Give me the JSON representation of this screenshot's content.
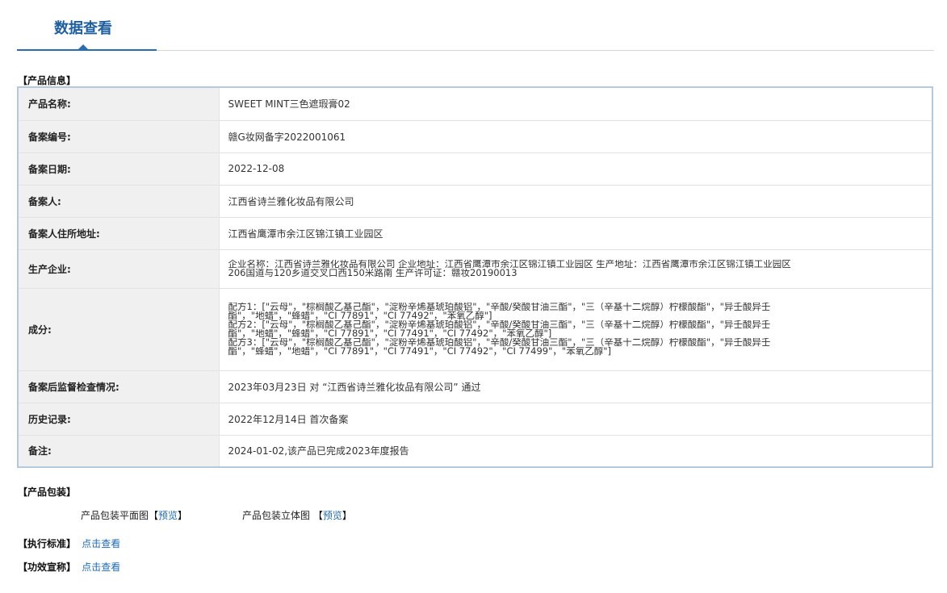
{
  "tab": {
    "title": "数据查看"
  },
  "product_info": {
    "heading": "【产品信息】",
    "rows": [
      {
        "label": "产品名称:",
        "value": "SWEET MINT三色遮瑕膏02"
      },
      {
        "label": "备案编号:",
        "value": "赣G妆网备字2022001061"
      },
      {
        "label": "备案日期:",
        "value": "2022-12-08"
      },
      {
        "label": "备案人:",
        "value": "江西省诗兰雅化妆品有限公司"
      },
      {
        "label": "备案人住所地址:",
        "value": "江西省鹰潭市余江区锦江镇工业园区"
      },
      {
        "label": "生产企业:",
        "lines": [
          "企业名称：江西省诗兰雅化妆品有限公司 企业地址：江西省鹰潭市余江区锦江镇工业园区 生产地址：江西省鹰潭市余江区锦江镇工业园区",
          "206国道与120乡道交叉口西150米路南 生产许可证：赣妆20190013"
        ]
      },
      {
        "label": "成分:",
        "lines": [
          "配方1：[\"云母\"，\"棕榈酸乙基己酯\"，\"淀粉辛烯基琥珀酸铝\"，\"辛酸/癸酸甘油三酯\"，\"三（辛基十二烷醇）柠檬酸酯\"，\"异壬酸异壬",
          "酯\"，\"地蜡\"，\"蜂蜡\"，\"CI 77891\"，\"CI 77492\"，\"苯氧乙醇\"]",
          "配方2：[\"云母\"，\"棕榈酸乙基己酯\"，\"淀粉辛烯基琥珀酸铝\"，\"辛酸/癸酸甘油三酯\"，\"三（辛基十二烷醇）柠檬酸酯\"，\"异壬酸异壬",
          "酯\"，\"地蜡\"，\"蜂蜡\"，\"CI 77891\"，\"CI 77491\"，\"CI 77492\"，\"苯氧乙醇\"]",
          "配方3：[\"云母\"，\"棕榈酸乙基己酯\"，\"淀粉辛烯基琥珀酸铝\"，\"辛酸/癸酸甘油三酯\"，\"三（辛基十二烷醇）柠檬酸酯\"，\"异壬酸异壬",
          "酯\"，\"蜂蜡\"，\"地蜡\"，\"CI 77891\"，\"CI 77491\"，\"CI 77492\"，\"CI 77499\"，\"苯氧乙醇\"]"
        ]
      },
      {
        "label": "备案后监督检查情况:",
        "value": "2023年03月23日 对 “江西省诗兰雅化妆品有限公司” 通过"
      },
      {
        "label": "历史记录:",
        "value": "2022年12月14日 首次备案"
      },
      {
        "label": "备注:",
        "value": "2024-01-02,该产品已完成2023年度报告"
      }
    ]
  },
  "packaging": {
    "heading": "【产品包装】",
    "flat_label": "产品包装平面图",
    "flat_link": "预览",
    "three_d_label": "产品包装立体图",
    "three_d_link": "预览",
    "open_bracket": "【",
    "close_bracket": "】"
  },
  "standard": {
    "heading": "【执行标准】",
    "link": "点击查看"
  },
  "efficacy": {
    "heading": "【功效宣称】",
    "link": "点击查看"
  },
  "colors": {
    "accent": "#1e5fa0",
    "link": "#1e6bb8",
    "border": "#b5c9dc",
    "label_bg": "#f0f0f0"
  }
}
